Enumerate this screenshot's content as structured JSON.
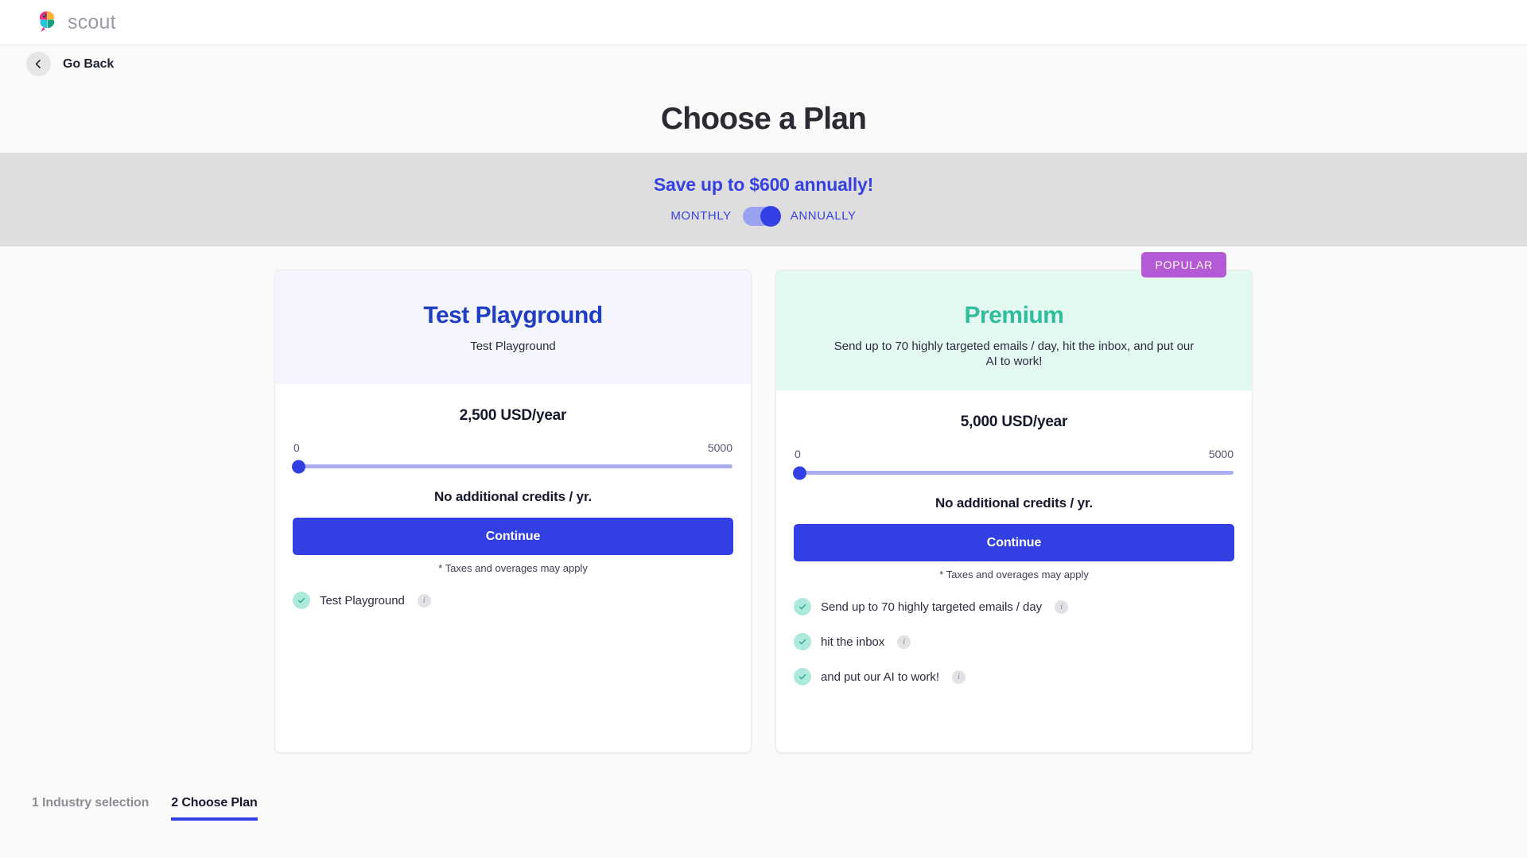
{
  "brand": {
    "name": "scout",
    "logo_icon": "scout-parrot-logo"
  },
  "nav": {
    "back_label": "Go Back",
    "back_icon": "chevron-left-icon"
  },
  "page": {
    "title": "Choose a Plan"
  },
  "promo": {
    "headline": "Save up to $600 annually!",
    "monthly_label": "MONTHLY",
    "annually_label": "ANNUALLY",
    "toggle_state": "ANNUALLY",
    "accent_color": "#3741e0",
    "banner_color": "#dedede"
  },
  "plans": [
    {
      "id": "test-playground",
      "title": "Test Playground",
      "subtitle": "Test Playground",
      "title_color": "#1f3ec0",
      "header_bg": "#f5f6fd",
      "price": "2,500 USD/year",
      "slider": {
        "min_label": "0",
        "max_label": "5000",
        "value": 0,
        "min": 0,
        "max": 5000
      },
      "credits_note": "No additional credits / yr.",
      "cta_label": "Continue",
      "taxes_note": "* Taxes and overages may apply",
      "badge": null,
      "features": [
        {
          "label": "Test Playground",
          "info_icon": "info-icon"
        }
      ]
    },
    {
      "id": "premium",
      "title": "Premium",
      "subtitle": "Send up to 70 highly targeted emails / day, hit the inbox, and put our AI to work!",
      "title_color": "#2fbd9d",
      "header_bg": "#e4f8f2",
      "price": "5,000 USD/year",
      "slider": {
        "min_label": "0",
        "max_label": "5000",
        "value": 0,
        "min": 0,
        "max": 5000
      },
      "credits_note": "No additional credits / yr.",
      "cta_label": "Continue",
      "taxes_note": "* Taxes and overages may apply",
      "badge": {
        "label": "POPULAR",
        "color": "#b45ad4"
      },
      "features": [
        {
          "label": "Send up to 70 highly targeted emails / day",
          "info_icon": "info-icon"
        },
        {
          "label": "hit the inbox",
          "info_icon": "info-icon"
        },
        {
          "label": "and put our AI to work!",
          "info_icon": "info-icon"
        }
      ]
    }
  ],
  "steps": [
    {
      "label": "1 Industry selection",
      "active": false
    },
    {
      "label": "2 Choose Plan",
      "active": true
    }
  ]
}
